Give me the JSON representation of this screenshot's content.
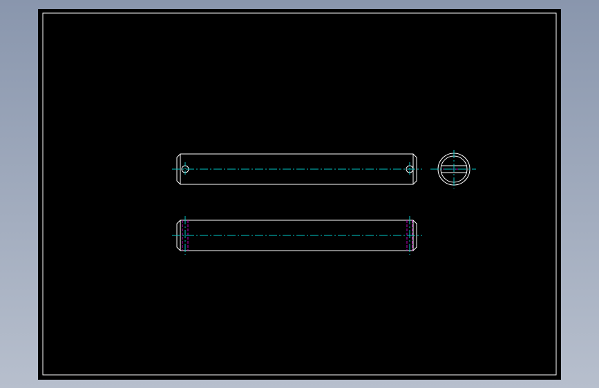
{
  "viewport": {
    "background_top": "#8996ad",
    "background_bottom": "#b7bfcd"
  },
  "sheet": {
    "background": "#000000",
    "border_color": "#ffffff"
  },
  "colors": {
    "outline": "#ffffff",
    "centerline": "#00c8c8",
    "hidden_line": "#c000c0"
  },
  "views": [
    {
      "name": "front-view",
      "kind": "pin-with-cross-holes"
    },
    {
      "name": "end-view",
      "kind": "circular-section"
    },
    {
      "name": "bottom-view",
      "kind": "pin-with-grooves"
    }
  ]
}
